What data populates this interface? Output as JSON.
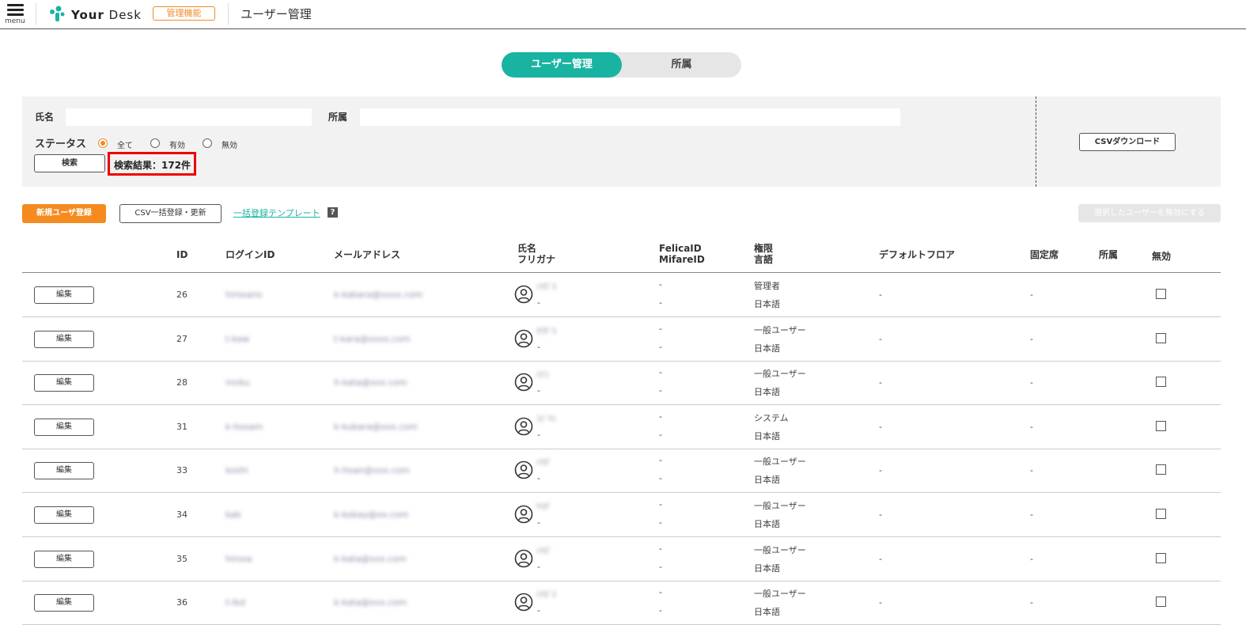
{
  "header": {
    "menu_label": "menu",
    "logo_text_bold": "Your",
    "logo_text_rest": "Desk",
    "admin_badge": "管理機能",
    "page_title": "ユーザー管理"
  },
  "tabs": {
    "active": "ユーザー管理",
    "inactive": "所属"
  },
  "search": {
    "name_label": "氏名",
    "name_value": "",
    "dept_label": "所属",
    "dept_value": "",
    "status_label": "ステータス",
    "status_options": [
      "全て",
      "有効",
      "無効"
    ],
    "status_selected": "全て",
    "search_button": "検索",
    "result_text": "検索結果：172件",
    "csv_download": "CSVダウンロード"
  },
  "actions": {
    "new_user": "新規ユーザ登録",
    "csv_bulk": "CSV一括登録・更新",
    "template_link": "一括登録テンプレート",
    "help": "?",
    "disable_selected": "選択したユーザーを無効にする"
  },
  "table": {
    "headers": {
      "id": "ID",
      "login_id": "ログインID",
      "email": "メールアドレス",
      "name": "氏名",
      "furigana": "フリガナ",
      "felica": "FelicaID",
      "mifare": "MifareID",
      "role": "権限",
      "language": "言語",
      "default_floor": "デフォルトフロア",
      "fixed_seat": "固定席",
      "dept": "所属",
      "disabled": "無効"
    },
    "edit_label": "編集",
    "rows": [
      {
        "id": "26",
        "login": "hirosans",
        "email": "k-kabara@xxxx.com",
        "name": "ﾄﾁｶﾞﾈ",
        "furigana": "-",
        "felica": "-",
        "mifare": "-",
        "role": "管理者",
        "language": "日本語",
        "floor": "-",
        "seat": "-",
        "dept": ""
      },
      {
        "id": "27",
        "login": "t-kaw",
        "email": "t-kara@xxxx.com",
        "name": "ｶﾜﾀﾞｶ",
        "furigana": "-",
        "felica": "-",
        "mifare": "-",
        "role": "一般ユーザー",
        "language": "日本語",
        "floor": "-",
        "seat": "-",
        "dept": ""
      },
      {
        "id": "28",
        "login": "mnku",
        "email": "h-kata@xxx.com",
        "name": "ﾊﾅｺ",
        "furigana": "-",
        "felica": "-",
        "mifare": "-",
        "role": "一般ユーザー",
        "language": "日本語",
        "floor": "-",
        "seat": "-",
        "dept": ""
      },
      {
        "id": "31",
        "login": "k-hosam",
        "email": "k-kubara@xxx.com",
        "name": "ｺﾊﾞﾔｼ",
        "furigana": "-",
        "felica": "-",
        "mifare": "-",
        "role": "システム",
        "language": "日本語",
        "floor": "-",
        "seat": "-",
        "dept": ""
      },
      {
        "id": "33",
        "login": "koshi",
        "email": "h-hoan@xxx.com",
        "name": "ﾄﾁｶﾞ",
        "furigana": "-",
        "felica": "-",
        "mifare": "-",
        "role": "一般ユーザー",
        "language": "日本語",
        "floor": "-",
        "seat": "-",
        "dept": ""
      },
      {
        "id": "34",
        "login": "kab",
        "email": "k-kobay@xx.com",
        "name": "ﾔﾏﾀﾞ",
        "furigana": "-",
        "felica": "-",
        "mifare": "-",
        "role": "一般ユーザー",
        "language": "日本語",
        "floor": "-",
        "seat": "-",
        "dept": ""
      },
      {
        "id": "35",
        "login": "hirosa",
        "email": "k-kata@xxx.com",
        "name": "ﾄﾁｶﾞ",
        "furigana": "-",
        "felica": "-",
        "mifare": "-",
        "role": "一般ユーザー",
        "language": "日本語",
        "floor": "-",
        "seat": "-",
        "dept": ""
      },
      {
        "id": "36",
        "login": "t-ikd",
        "email": "k-kata@xxx.com",
        "name": "ﾄﾁｶﾞﾈ",
        "furigana": "-",
        "felica": "-",
        "mifare": "-",
        "role": "一般ユーザー",
        "language": "日本語",
        "floor": "-",
        "seat": "-",
        "dept": ""
      }
    ]
  },
  "colors": {
    "accent": "#19b3a2",
    "orange": "#f58b1e",
    "highlight": "#ee0000"
  }
}
